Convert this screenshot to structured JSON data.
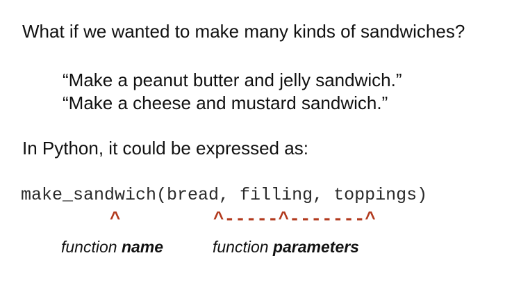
{
  "slide": {
    "question": "What if we wanted to make many kinds of sandwiches?",
    "examples": [
      "“Make a peanut butter and jelly sandwich.”",
      "“Make a cheese and mustard sandwich.”"
    ],
    "python_intro": "In Python, it could be expressed as:",
    "code": "make_sandwich(bread, filling, toppings)",
    "markers": {
      "name_marker": "^",
      "params_marker": "^-----^-------^"
    },
    "labels": {
      "name_prefix": "function ",
      "name_strong": "name",
      "params_prefix": "function ",
      "params_strong": "parameters"
    },
    "colors": {
      "marker": "#b23a1e",
      "text": "#111111"
    }
  }
}
